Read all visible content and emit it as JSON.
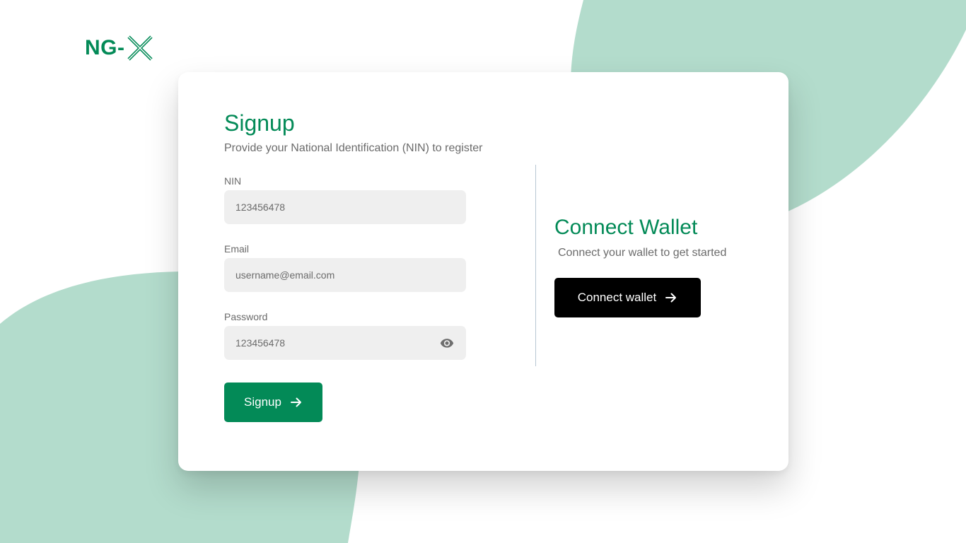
{
  "colors": {
    "brand_green": "#038a57",
    "mint": "#b3dccc",
    "black": "#000000",
    "field_bg": "#efefef",
    "muted_text": "#6b6b6b",
    "divider": "#b7c6d3"
  },
  "logo": {
    "text": "NG-",
    "mark_icon": "x-logo-icon"
  },
  "signup": {
    "title": "Signup",
    "subtitle": "Provide your National Identification (NIN) to register",
    "nin": {
      "label": "NIN",
      "value": "123456478"
    },
    "email": {
      "label": "Email",
      "value": "username@email.com"
    },
    "password": {
      "label": "Password",
      "value": "123456478",
      "toggle_icon": "eye-icon"
    },
    "button_label": "Signup",
    "button_icon": "arrow-right-icon"
  },
  "wallet": {
    "title": "Connect Wallet",
    "subtitle": "Connect your wallet to get started",
    "button_label": "Connect wallet",
    "button_icon": "arrow-right-icon"
  }
}
